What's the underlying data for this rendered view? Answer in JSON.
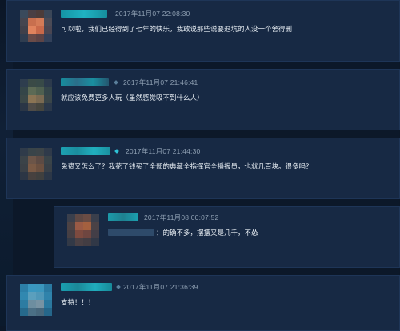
{
  "comments": [
    {
      "timestamp": "2017年11月07 22:08:30",
      "text": "可以啦，我们已经得到了七年的快乐，我敢说那些说要退坑的人没一个舍得删"
    },
    {
      "timestamp": "2017年11月07 21:46:41",
      "text": "就应该免费更多人玩（虽然感觉吸不到什么人）"
    },
    {
      "timestamp": "2017年11月07 21:44:30",
      "text": "免费又怎么了？我花了钱买了全部的典藏全指挥官全播报员，也就几百块。很多吗？"
    },
    {
      "timestamp": "2017年11月08 00:07:52",
      "text": "：的确不多，摆摆又是几千，不怂",
      "is_reply": true
    },
    {
      "timestamp": "2017年11月07 21:36:39",
      "text": "支持！！！"
    }
  ],
  "colors": {
    "background": "#0c1829",
    "panel": "#172944",
    "username_blur": "#1aa7b7",
    "timestamp": "#8fa0b3",
    "text": "#e6ecf2"
  }
}
